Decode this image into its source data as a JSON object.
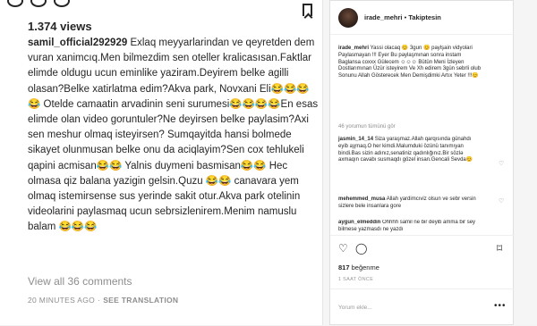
{
  "left_panel": {
    "views": "1.374 views",
    "comment_user": "samil_official292929",
    "comment_text": " Exlaq meyyarlarindan ve qeyretden dem vuran xanimcıq.Men bilmezdim sen oteller kralicasısan.Faktlar elimde oldugu ucun eminlike yaziram.Deyirem belke agilli olasan?Belke xatirlatma edim?Akva park, Novxani Eli😂😂😂😂 Otelde camaatin arvadinin seni surumesi😂😂😂😂En esas elimde olan video goruntuler?Ne deyirsen belke paylasim?Axi sen meshur olmaq isteyirsen? Sumqayitda hansi bolmede sikayet olunmusan belke onu da aciqlayim?Sen cox tehlukeli qapini acmisan😂😂 Yalnis duymeni basmisan😂😂 Hec olmasa qiz balana yazigin gelsin.Quzu 😂😂 canavara yem olmaq istemirsense sus yerinde sakit otur.Akva park otelinin videolarini paylasmaq ucun sebrsizlenirem.Menim namuslu balam 😂😂😂",
    "view_all": "View all 36 comments",
    "time_ago": "20 MINUTES AGO",
    "translate": "SEE TRANSLATION"
  },
  "post": {
    "author": "irade_mehri",
    "follow_label": "Takiptesin",
    "caption_user": "irade_mehri",
    "caption_text": " Yassi olacaq 😊 3gun 😊 paylşain vidyolari Paylasmayan !!! Eyer Bu paylaşmınan sonra instam Baglansa coxxx Gülecem ☺☺☺ Bütün Meni İzleyen Dostlarımınan Üzür isteyirem Ve Xh edirem 3gün sebrli olub Sonunu Allah Gösterecek Men Demişdimki Artıx Yeter !!!😊",
    "load_more": "46 yorumun tümünü gör",
    "comments": [
      {
        "user": "jasmin_14_14",
        "text": " Siza yaraşmaz.Allah qarqısında günahdı eyib aχmaq.O her kimdi.Malumduki özünü tanımıyan birıdi.Bas sizin adınız,senatiniz qadınlığınız.Bir sözlə axmaqın cavabı susmaqdı gözel insan.Gencali Sevda😊"
      },
      {
        "user": "mehemmed_musa",
        "text": " Allah yardimcıviz olsun ve sebr versin sizlere bele insanlara gore"
      },
      {
        "user": "aygun_elmeddin",
        "text": " Ohhhh samil ne bir deyib amma bir sey bilmese yazmasdı ne yazdı"
      }
    ],
    "likes": "817",
    "likes_label": "beğenme",
    "ago": "1 SAAT ÖNCE",
    "add_comment_placeholder": "Yorum ekle..."
  }
}
